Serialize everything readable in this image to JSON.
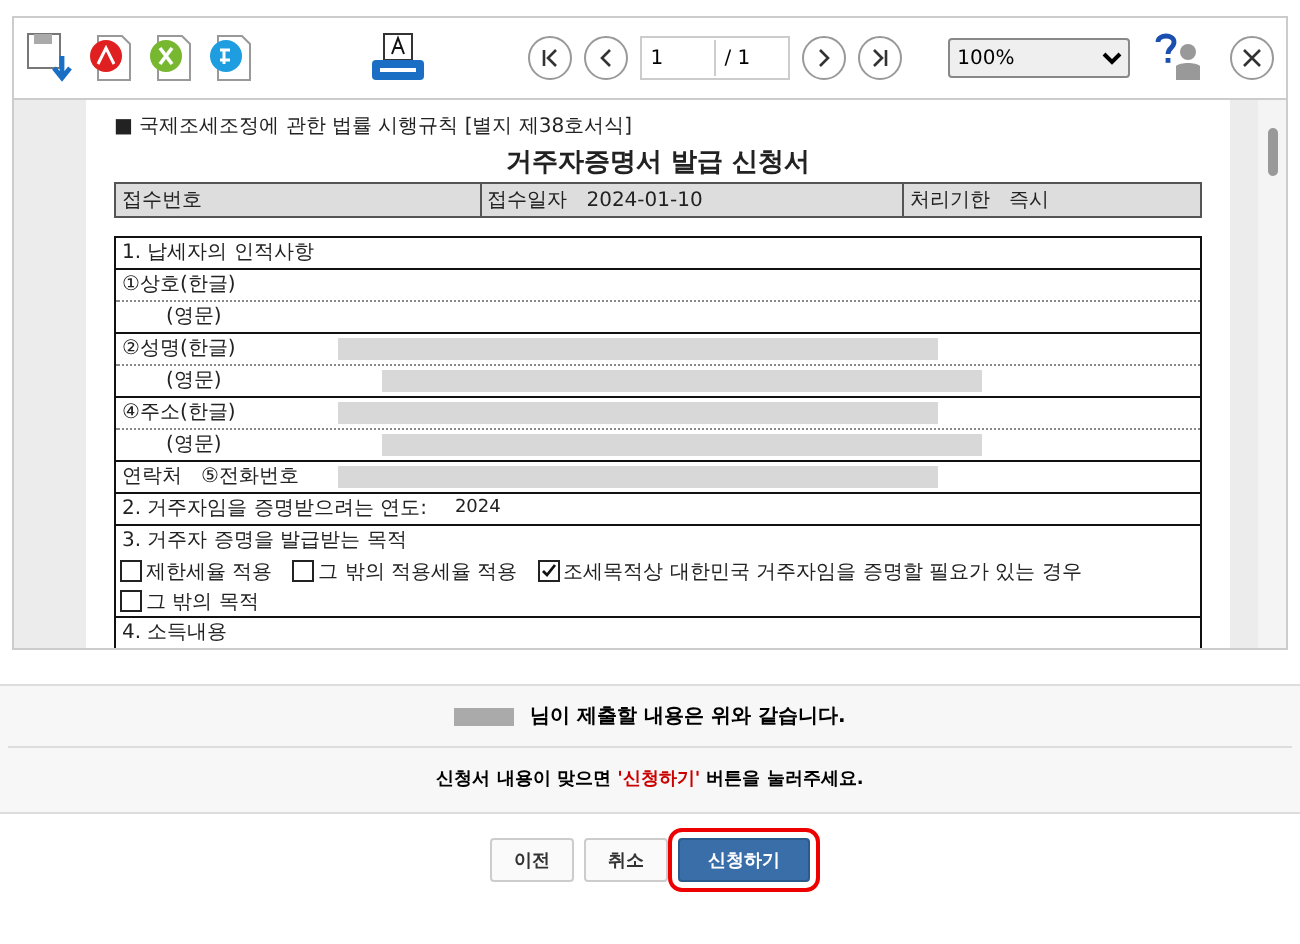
{
  "toolbar": {
    "page": "1",
    "total": "/ 1",
    "zoom": "100%"
  },
  "document": {
    "header_note": "■ 국제조세조정에 관한 법률 시행규칙 [별지 제38호서식]",
    "title": "거주자증명서 발급 신청서",
    "receipt": [
      {
        "label": "접수번호"
      },
      {
        "label": "접수일자",
        "value": "2024-01-10"
      },
      {
        "label": "처리기한",
        "value": "즉시"
      }
    ],
    "section1": "1. 납세자의 인적사항",
    "rows": [
      {
        "label": "①상호(한글)",
        "indent": false,
        "redacted": false,
        "dotted": true
      },
      {
        "label": "(영문)",
        "indent": true,
        "redacted": false,
        "dotted": false
      },
      {
        "label": "②성명(한글)",
        "indent": false,
        "redacted": true,
        "dotted": true
      },
      {
        "label": "(영문)",
        "indent": true,
        "redacted": true,
        "dotted": false
      },
      {
        "label": "④주소(한글)",
        "indent": false,
        "redacted": true,
        "dotted": true
      },
      {
        "label": "(영문)",
        "indent": true,
        "redacted": true,
        "dotted": false
      },
      {
        "label": "연락처   ⑤전화번호",
        "indent": false,
        "redacted": true,
        "dotted": false
      }
    ],
    "section2": {
      "label": "2. 거주자임을 증명받으려는 연도:",
      "value": "2024"
    },
    "section3": "3. 거주자 증명을 발급받는 목적",
    "purposes": [
      {
        "label": "제한세율 적용",
        "checked": false
      },
      {
        "label": "그 밖의 적용세율 적용",
        "checked": false
      },
      {
        "label": "조세목적상 대한민국 거주자임을 증명할 필요가 있는 경우",
        "checked": true
      },
      {
        "label": "그 밖의 목적",
        "checked": false
      }
    ],
    "section4": "4. 소득내용"
  },
  "message": "님이 제출할 내용은 위와 같습니다.",
  "instruction": {
    "before": "신청서 내용이 맞으면 ",
    "highlight": "'신청하기'",
    "after": " 버튼을 눌러주세요."
  },
  "buttons": [
    {
      "label": "이전",
      "kind": "default",
      "highlighted": false
    },
    {
      "label": "취소",
      "kind": "default",
      "highlighted": false
    },
    {
      "label": "신청하기",
      "kind": "primary",
      "highlighted": true
    }
  ]
}
